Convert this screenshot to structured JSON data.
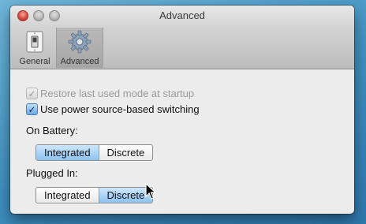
{
  "window": {
    "title": "Advanced"
  },
  "toolbar": {
    "items": [
      {
        "label": "General",
        "icon": "light-switch-icon",
        "selected": false
      },
      {
        "label": "Advanced",
        "icon": "gear-icon",
        "selected": true
      }
    ]
  },
  "options": {
    "restore_last_mode": {
      "label": "Restore last used mode at startup",
      "checked": true,
      "enabled": false
    },
    "power_switching": {
      "label": "Use power source-based switching",
      "checked": true,
      "enabled": true
    }
  },
  "battery": {
    "label": "On Battery:",
    "options": [
      "Integrated",
      "Discrete"
    ],
    "selected": "Integrated"
  },
  "plugged": {
    "label": "Plugged In:",
    "options": [
      "Integrated",
      "Discrete"
    ],
    "selected": "Discrete"
  },
  "colors": {
    "selection": "#8cc2f2",
    "close_button": "#d5463b"
  }
}
